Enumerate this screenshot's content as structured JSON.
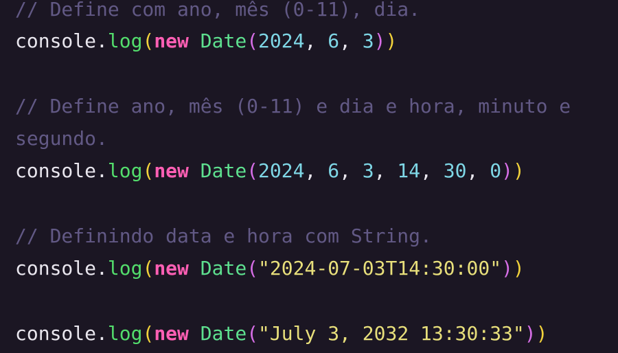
{
  "colors": {
    "background": "#1b1623",
    "comment": "#625985",
    "identifier": "#e9e6ee",
    "method": "#53dd6c",
    "keyword": "#ff5fb4",
    "class_name": "#5ee08f",
    "number": "#7fd7e6",
    "string": "#e8df7b",
    "paren_outer": "#f2d23b",
    "paren_inner": "#d66ee6"
  },
  "code": {
    "comment_1": "// Define com ano, mês (0-11), dia.",
    "comment_2a": "// Define ano, mês (0-11) e dia e hora, minuto e",
    "comment_2b": "segundo.",
    "comment_3": "// Definindo data e hora com String.",
    "t": {
      "console": "console",
      "dot": ".",
      "log": "log",
      "lparen": "(",
      "rparen": ")",
      "new": "new",
      "space": " ",
      "date": "Date",
      "comma": ", "
    },
    "line_2": {
      "args": [
        "2024",
        "6",
        "3"
      ]
    },
    "line_5": {
      "args": [
        "2024",
        "6",
        "3",
        "14",
        "30",
        "0"
      ]
    },
    "line_7": {
      "arg": "\"2024-07-03T14:30:00\""
    },
    "line_9": {
      "arg": "\"July 3, 2032 13:30:33\""
    }
  }
}
